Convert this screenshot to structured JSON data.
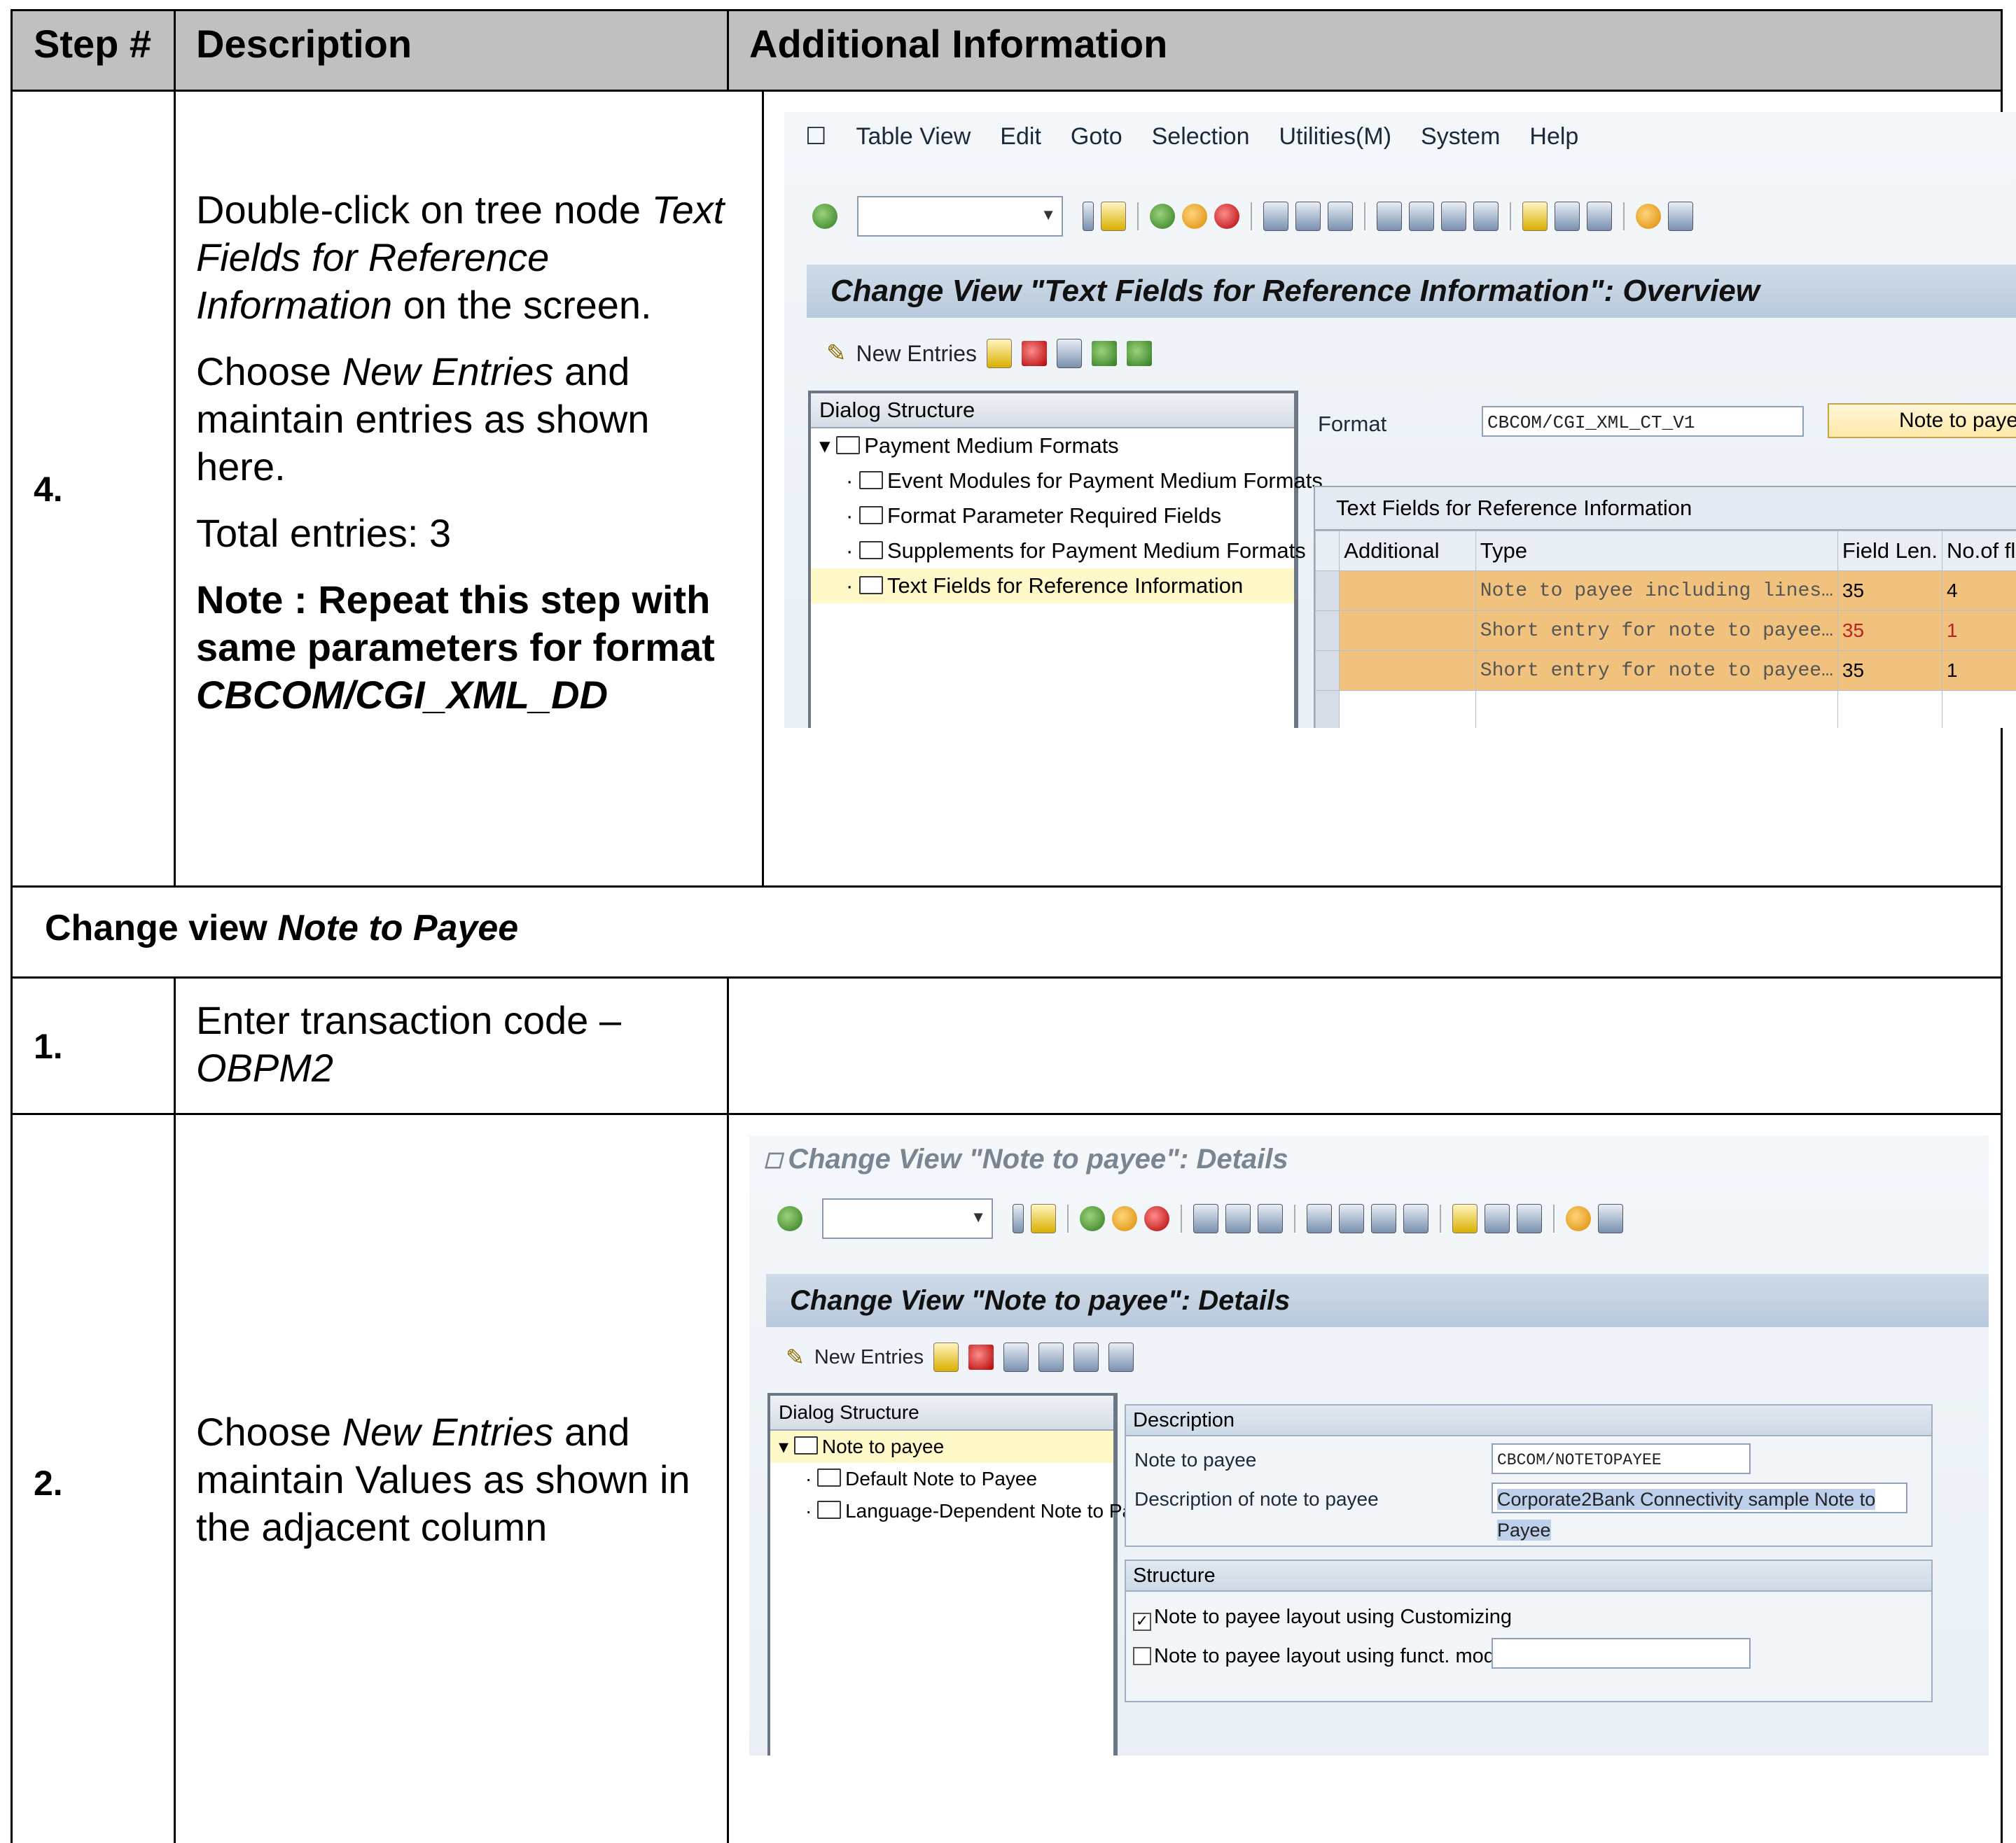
{
  "table": {
    "headers": {
      "step": "Step #",
      "description": "Description",
      "additional": "Additional Information"
    }
  },
  "row4": {
    "step": "4.",
    "p1_a": "Double-click on tree node ",
    "p1_i": "Text Fields for Reference Information",
    "p1_b": " on the screen.",
    "p2_a": "Choose ",
    "p2_i": "New Entries",
    "p2_b": " and maintain entries as shown here.",
    "p3": "Total entries: 3",
    "note_a": "Note :  Repeat this step with same parameters for format ",
    "note_i": "CBCOM/CGI_XML_DD"
  },
  "section": {
    "prefix": "Change view ",
    "italic": "Note to Payee"
  },
  "row1": {
    "step": "1.",
    "text_a": "Enter transaction code –",
    "text_i": "OBPM2"
  },
  "row2": {
    "step": "2.",
    "text_a": "Choose ",
    "text_i": "New Entries",
    "text_b": " and maintain Values as shown in the adjacent column"
  },
  "sap1": {
    "menu": [
      "Table View",
      "Edit",
      "Goto",
      "Selection",
      "Utilities(M)",
      "System",
      "Help"
    ],
    "title": "Change View \"Text Fields for Reference Information\": Overview",
    "new_entries": "New Entries",
    "tree_header": "Dialog Structure",
    "tree": [
      "Payment Medium Formats",
      "Event Modules for Payment Medium Formats",
      "Format Parameter Required Fields",
      "Supplements for Payment Medium Formats",
      "Text Fields for Reference Information"
    ],
    "format_label": "Format",
    "format_value": "CBCOM/CGI_XML_CT_V1",
    "note_button": "Note to payee",
    "grid_title": "Text Fields for Reference Information",
    "columns": [
      "Additional",
      "Type",
      "Field Len.",
      "No.of flds"
    ],
    "rows": [
      {
        "type": "Note to payee including lines…",
        "len": "35",
        "num": "4"
      },
      {
        "type": "Short entry for note to payee…",
        "len": "35",
        "num": "1"
      },
      {
        "type": "Short entry for note to payee…",
        "len": "35",
        "num": "1"
      }
    ]
  },
  "sap2": {
    "window_title": "Change View \"Note to payee\": Details",
    "title": "Change View \"Note to payee\": Details",
    "new_entries": "New Entries",
    "tree_header": "Dialog Structure",
    "tree": [
      "Note to payee",
      "Default Note to Payee",
      "Language-Dependent Note to Payee"
    ],
    "desc_group": "Description",
    "note_label": "Note to payee",
    "note_value": "CBCOM/NOTETOPAYEE",
    "desc_label": "Description of note to payee",
    "desc_value": "Corporate2Bank Connectivity sample Note to Payee",
    "struct_group": "Structure",
    "cb1": "Note to payee layout using Customizing",
    "cb1_checked": "✓",
    "cb2": "Note to payee layout using funct. module"
  }
}
